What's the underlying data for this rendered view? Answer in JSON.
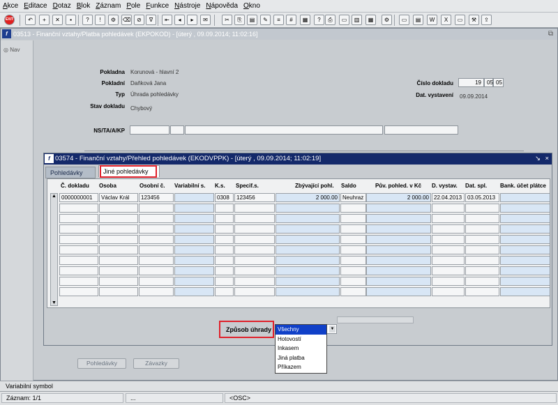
{
  "menu": [
    "Akce",
    "Editace",
    "Dotaz",
    "Blok",
    "Záznam",
    "Pole",
    "Funkce",
    "Nástroje",
    "Nápověda",
    "Okno"
  ],
  "toolbar": {
    "exit_label": "EXIT"
  },
  "main_window": {
    "title": "03513 - Finanční vztahy/Platba pohledávek (EKPOKOD) - [úterý   , 09.09.2014; 11:02:16]",
    "nav_label": "Nav"
  },
  "form": {
    "pokladna_label": "Pokladna",
    "pokladna_value": "Korunová - hlavní 2",
    "pokladni_label": "Pokladní",
    "pokladni_value": "Daňková Jana",
    "typ_label": "Typ",
    "typ_value": "Úhrada pohledávky",
    "stav_label": "Stav dokladu",
    "stav_value": "Chybový",
    "cislo_label": "Číslo dokladu",
    "cislo_1": "19",
    "cislo_2": "05",
    "cislo_3": "05",
    "datum_label": "Dat. vystavení",
    "datum_value": "09.09.2014",
    "nstakp_label": "NS/TA/A/KP"
  },
  "inner_window": {
    "title": "03574 - Finanční vztahy/Přehled pohledávek (EKODVPPK) - [úterý   , 09.09.2014; 11:02:19]",
    "tabs": [
      "Pohledávky",
      "Jiné pohledávky"
    ],
    "columns": [
      "Č. dokladu",
      "Osoba",
      "Osobní č.",
      "Variabilní s.",
      "K.s.",
      "Specif.s.",
      "Zbývající pohl.",
      "Saldo",
      "Pův. pohled. v Kč",
      "D. vystav.",
      "Dat. spl.",
      "Bank. účet plátce"
    ],
    "row1": {
      "doklad": "0000000001",
      "osoba": "Václav Král",
      "osobni": "123456",
      "var": "",
      "ks": "0308",
      "spec": "123456",
      "zbyv": "2 000.00",
      "saldo": "Neuhraz",
      "puv": "2 000.00",
      "dvyst": "22.04.2013",
      "dspl": "03.05.2013",
      "ucet": ""
    },
    "zpusob_label": "Způsob úhrady",
    "options": [
      "Všechny",
      "Hotovostí",
      "Inkasem",
      "Jiná platba",
      "Příkazem"
    ],
    "selected_option": "Všechny"
  },
  "buttons": {
    "pohledavky": "Pohledávky",
    "zavazky": "Závazky"
  },
  "status": {
    "field_hint": "Variabilní symbol",
    "record": "Záznam: 1/1",
    "seg2": "...",
    "osc": "<OSC>"
  }
}
